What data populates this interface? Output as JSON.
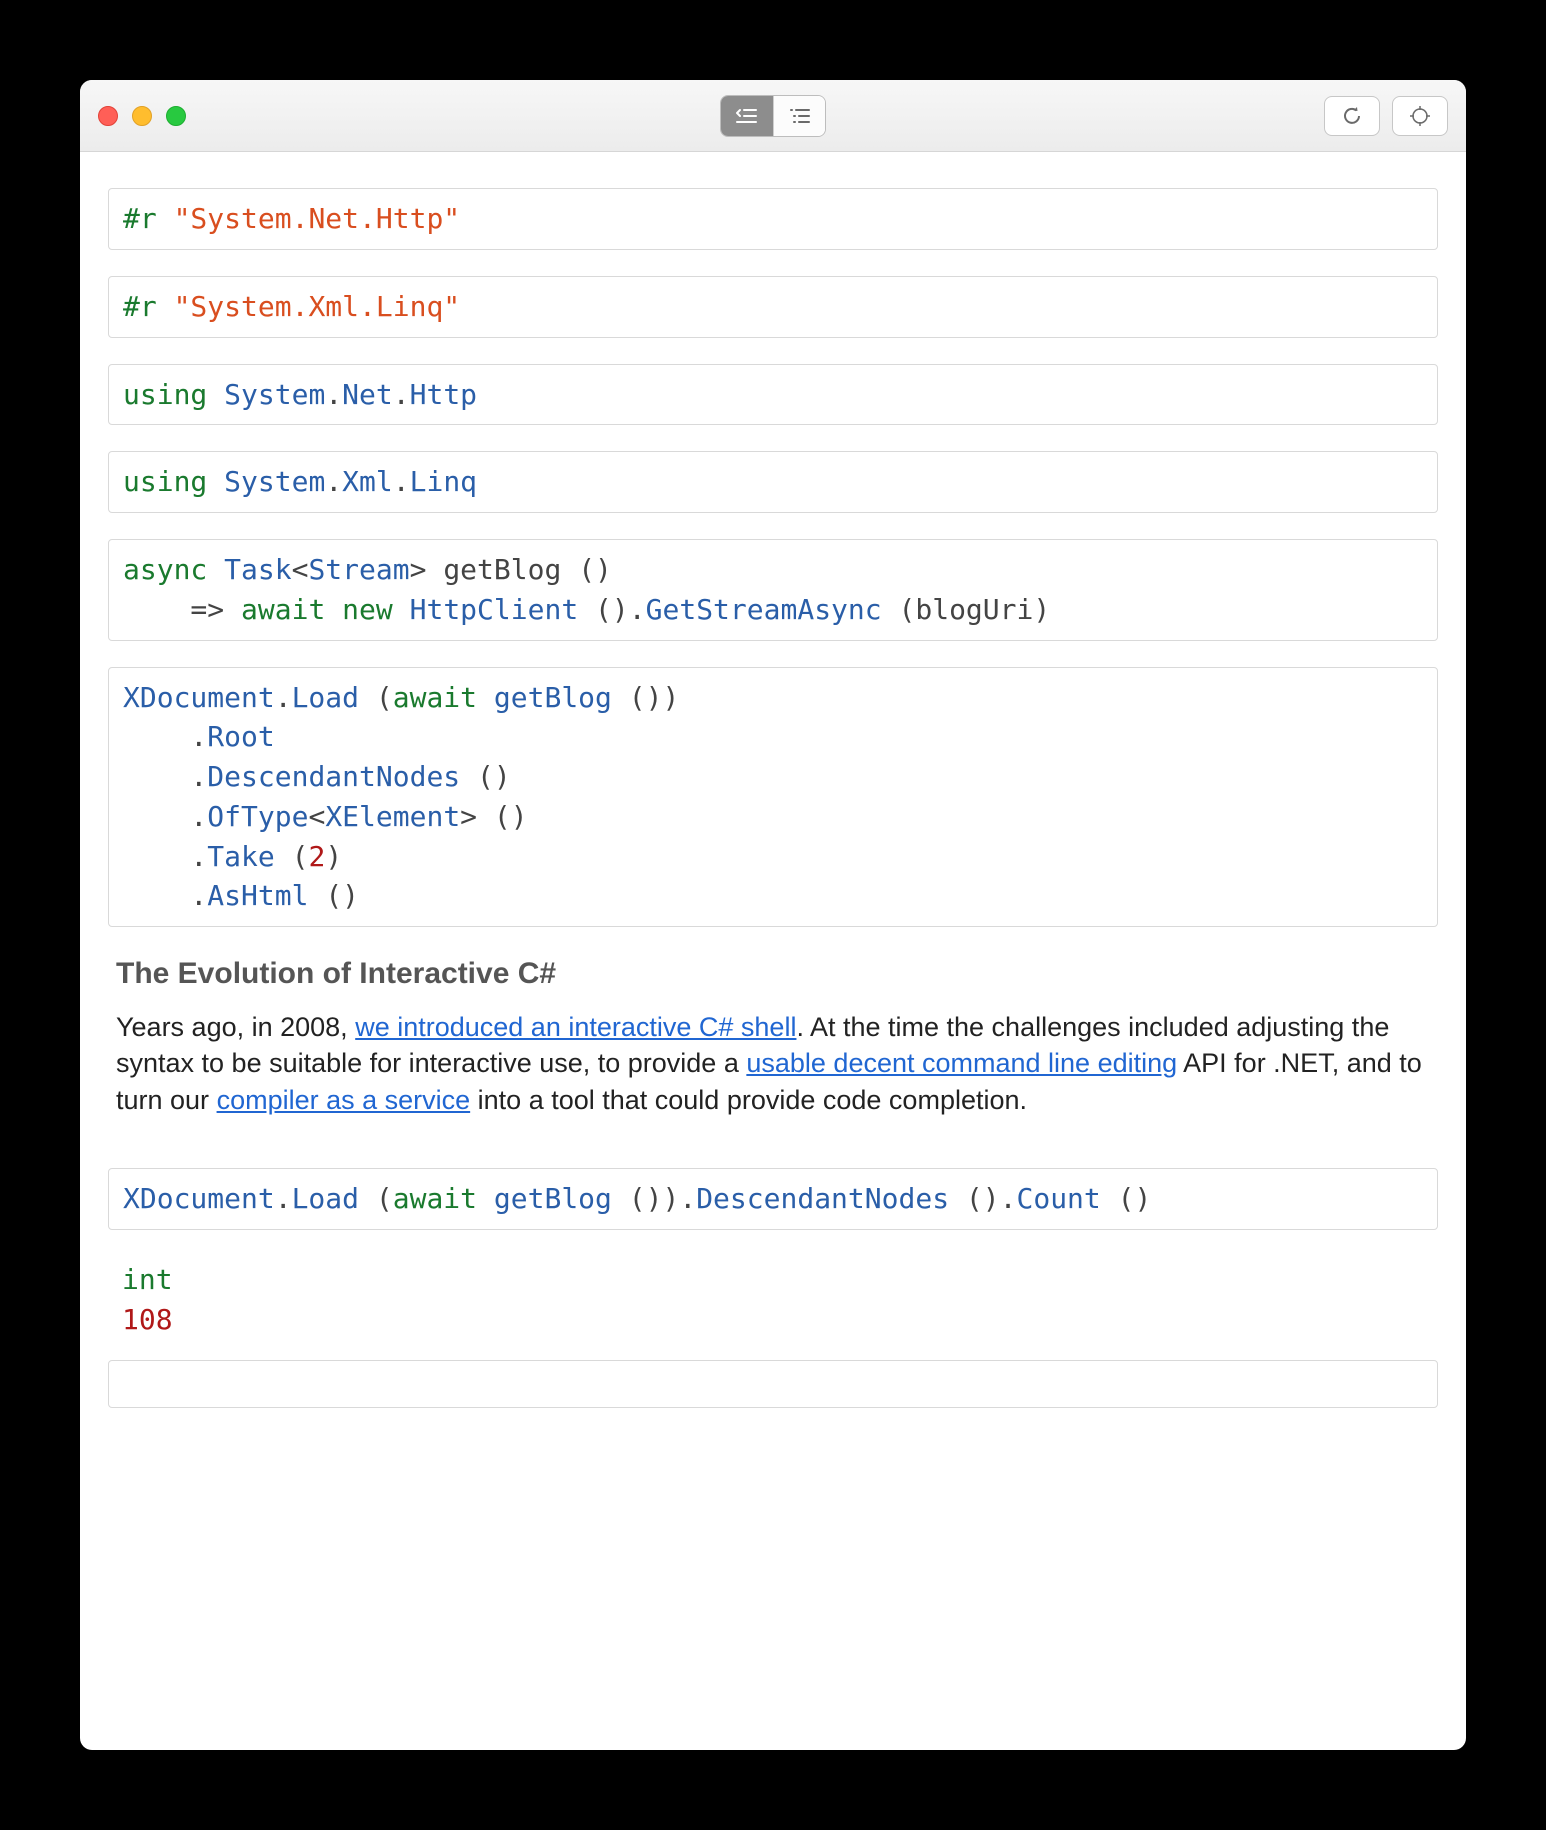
{
  "toolbar": {
    "mode_icons": [
      "code-list",
      "outline"
    ],
    "right_icons": [
      "refresh",
      "target"
    ]
  },
  "cells": [
    {
      "tokens": [
        {
          "t": "#r ",
          "c": "tok-keyword"
        },
        {
          "t": "\"System.Net.Http\"",
          "c": "tok-string"
        }
      ]
    },
    {
      "tokens": [
        {
          "t": "#r ",
          "c": "tok-keyword"
        },
        {
          "t": "\"System.Xml.Linq\"",
          "c": "tok-string"
        }
      ]
    },
    {
      "tokens": [
        {
          "t": "using ",
          "c": "tok-keyword"
        },
        {
          "t": "System",
          "c": "tok-type"
        },
        {
          "t": ".",
          "c": "tok-punct"
        },
        {
          "t": "Net",
          "c": "tok-type"
        },
        {
          "t": ".",
          "c": "tok-punct"
        },
        {
          "t": "Http",
          "c": "tok-type"
        }
      ]
    },
    {
      "tokens": [
        {
          "t": "using ",
          "c": "tok-keyword"
        },
        {
          "t": "System",
          "c": "tok-type"
        },
        {
          "t": ".",
          "c": "tok-punct"
        },
        {
          "t": "Xml",
          "c": "tok-type"
        },
        {
          "t": ".",
          "c": "tok-punct"
        },
        {
          "t": "Linq",
          "c": "tok-type"
        }
      ]
    },
    {
      "tokens": [
        {
          "t": "async ",
          "c": "tok-keyword"
        },
        {
          "t": "Task",
          "c": "tok-type"
        },
        {
          "t": "<",
          "c": "tok-punct"
        },
        {
          "t": "Stream",
          "c": "tok-type"
        },
        {
          "t": "> ",
          "c": "tok-punct"
        },
        {
          "t": "getBlog ",
          "c": "tok-ident"
        },
        {
          "t": "()\n",
          "c": "tok-punct"
        },
        {
          "t": "    => ",
          "c": "tok-punct"
        },
        {
          "t": "await ",
          "c": "tok-keyword"
        },
        {
          "t": "new ",
          "c": "tok-keyword"
        },
        {
          "t": "HttpClient ",
          "c": "tok-type"
        },
        {
          "t": "().",
          "c": "tok-punct"
        },
        {
          "t": "GetStreamAsync ",
          "c": "tok-method"
        },
        {
          "t": "(",
          "c": "tok-punct"
        },
        {
          "t": "blogUri",
          "c": "tok-ident"
        },
        {
          "t": ")",
          "c": "tok-punct"
        }
      ]
    },
    {
      "tokens": [
        {
          "t": "XDocument",
          "c": "tok-type"
        },
        {
          "t": ".",
          "c": "tok-punct"
        },
        {
          "t": "Load ",
          "c": "tok-method"
        },
        {
          "t": "(",
          "c": "tok-punct"
        },
        {
          "t": "await ",
          "c": "tok-keyword"
        },
        {
          "t": "getBlog ",
          "c": "tok-method"
        },
        {
          "t": "())\n",
          "c": "tok-punct"
        },
        {
          "t": "    .",
          "c": "tok-punct"
        },
        {
          "t": "Root",
          "c": "tok-method"
        },
        {
          "t": "\n    .",
          "c": "tok-punct"
        },
        {
          "t": "DescendantNodes ",
          "c": "tok-method"
        },
        {
          "t": "()\n",
          "c": "tok-punct"
        },
        {
          "t": "    .",
          "c": "tok-punct"
        },
        {
          "t": "OfType",
          "c": "tok-method"
        },
        {
          "t": "<",
          "c": "tok-punct"
        },
        {
          "t": "XElement",
          "c": "tok-type"
        },
        {
          "t": "> ()\n",
          "c": "tok-punct"
        },
        {
          "t": "    .",
          "c": "tok-punct"
        },
        {
          "t": "Take ",
          "c": "tok-method"
        },
        {
          "t": "(",
          "c": "tok-punct"
        },
        {
          "t": "2",
          "c": "tok-number"
        },
        {
          "t": ")\n",
          "c": "tok-punct"
        },
        {
          "t": "    .",
          "c": "tok-punct"
        },
        {
          "t": "AsHtml ",
          "c": "tok-method"
        },
        {
          "t": "()",
          "c": "tok-punct"
        }
      ]
    }
  ],
  "output": {
    "heading": "The Evolution of Interactive C#",
    "para_parts": [
      {
        "t": "Years ago, in 2008, ",
        "link": false
      },
      {
        "t": "we introduced an interactive C# shell",
        "link": true
      },
      {
        "t": ". At the time the challenges included adjusting the syntax to be suitable for interactive use, to provide a ",
        "link": false
      },
      {
        "t": "usable decent command line editing",
        "link": true
      },
      {
        "t": " API for .NET, and to turn our ",
        "link": false
      },
      {
        "t": "compiler as a service",
        "link": true
      },
      {
        "t": " into a tool that could provide code completion.",
        "link": false
      }
    ]
  },
  "cell7": {
    "tokens": [
      {
        "t": "XDocument",
        "c": "tok-type"
      },
      {
        "t": ".",
        "c": "tok-punct"
      },
      {
        "t": "Load ",
        "c": "tok-method"
      },
      {
        "t": "(",
        "c": "tok-punct"
      },
      {
        "t": "await ",
        "c": "tok-keyword"
      },
      {
        "t": "getBlog ",
        "c": "tok-method"
      },
      {
        "t": "()).",
        "c": "tok-punct"
      },
      {
        "t": "DescendantNodes ",
        "c": "tok-method"
      },
      {
        "t": "().",
        "c": "tok-punct"
      },
      {
        "t": "Count ",
        "c": "tok-method"
      },
      {
        "t": "()",
        "c": "tok-punct"
      }
    ]
  },
  "result": {
    "type_label": "int",
    "value": "108"
  }
}
